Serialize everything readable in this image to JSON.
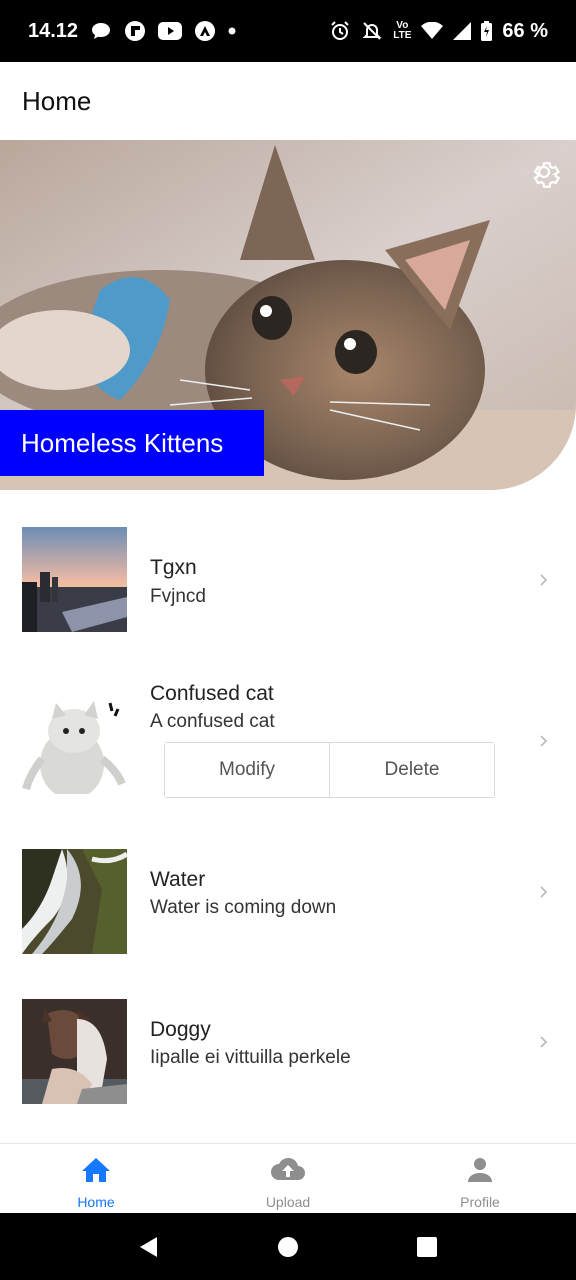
{
  "status_bar": {
    "time": "14.12",
    "net_label_top": "Vo",
    "net_label_bottom": "LTE",
    "battery": "66 %",
    "icons": [
      "chat-bubble-icon",
      "flipboard-icon",
      "youtube-icon",
      "astro-icon",
      "dot-icon",
      "alarm-icon",
      "mute-bell-icon",
      "wifi-icon",
      "signal-icon",
      "battery-icon"
    ]
  },
  "header": {
    "title": "Home"
  },
  "hero": {
    "title": "Homeless Kittens",
    "settings_icon": "gear-icon",
    "image": "kitten-photo"
  },
  "items": [
    {
      "title": "Tgxn",
      "subtitle": "Fvjncd",
      "image": "city-sunset-photo"
    },
    {
      "title": "Confused cat",
      "subtitle": "A confused cat",
      "image": "confused-cat-photo",
      "actions": {
        "modify": "Modify",
        "delete": "Delete"
      }
    },
    {
      "title": "Water",
      "subtitle": "Water is coming down",
      "image": "waterfall-photo"
    },
    {
      "title": "Doggy",
      "subtitle": "Iipalle ei vittuilla perkele",
      "image": "dog-photo"
    }
  ],
  "tabs": [
    {
      "label": "Home",
      "icon": "home-icon",
      "active": true
    },
    {
      "label": "Upload",
      "icon": "cloud-upload-icon",
      "active": false
    },
    {
      "label": "Profile",
      "icon": "person-icon",
      "active": false
    }
  ],
  "colors": {
    "accent": "#1677ff",
    "hero_label_bg": "#0000ff",
    "inactive": "#8e8e8e"
  }
}
